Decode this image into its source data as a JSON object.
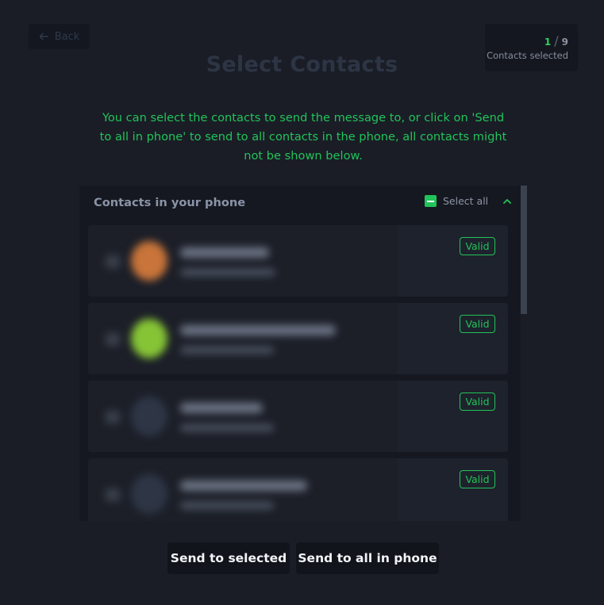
{
  "header": {
    "back_label": "Back",
    "back_icon": "arrow-left-icon",
    "title": "Select Contacts"
  },
  "counter": {
    "selected": "1",
    "total": "9",
    "caption": "Contacts selected"
  },
  "description": "You can select the contacts to send the message to, or click on 'Send to all in phone' to send to all contacts in the phone, all contacts might not be shown below.",
  "contacts_panel": {
    "title": "Contacts in your phone",
    "select_all_label": "Select all",
    "collapse_icon": "chevron-up-icon",
    "contacts": [
      {
        "status": "Valid",
        "avatar_color": "#c8743a"
      },
      {
        "status": "Valid",
        "avatar_color": "#86c436"
      },
      {
        "status": "Valid",
        "avatar_color": "#2e3646"
      },
      {
        "status": "Valid",
        "avatar_color": "#2e3646"
      }
    ]
  },
  "actions": {
    "send_selected": "Send to selected",
    "send_all": "Send to all in phone"
  },
  "colors": {
    "accent": "#22c35a",
    "background": "#1a1d26"
  }
}
